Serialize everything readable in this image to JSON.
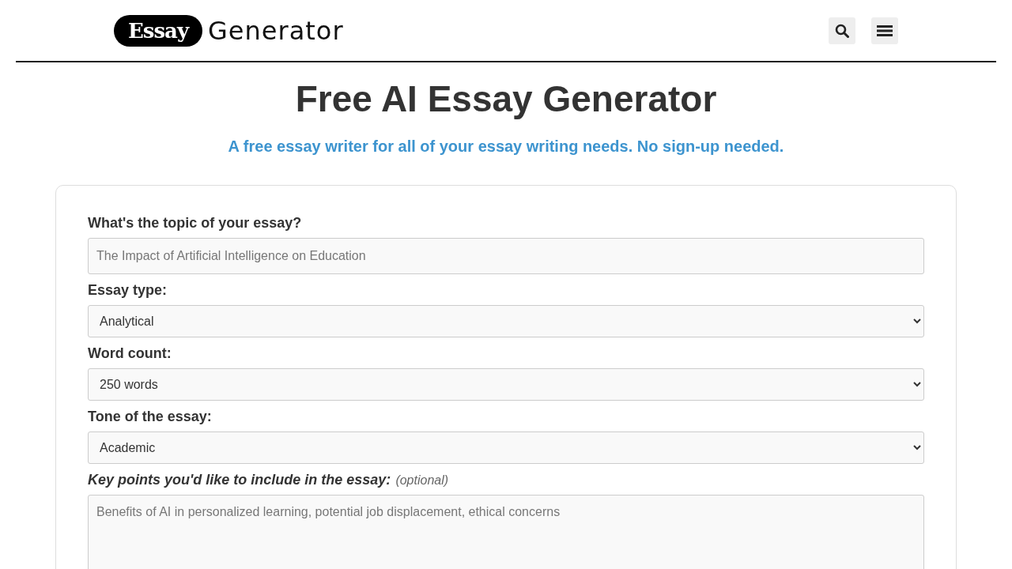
{
  "header": {
    "logo_badge": "Essay",
    "logo_text": "Generator"
  },
  "hero": {
    "title": "Free AI Essay Generator",
    "subtitle": "A free essay writer for all of your essay writing needs. No sign-up needed."
  },
  "form": {
    "fields": [
      {
        "kind": "text",
        "label": "What's the topic of your essay?",
        "placeholder": "The Impact of Artificial Intelligence on Education"
      },
      {
        "kind": "select",
        "label": "Essay type:",
        "value": "Analytical"
      },
      {
        "kind": "select",
        "label": "Word count:",
        "value": "250 words"
      },
      {
        "kind": "select",
        "label": "Tone of the essay:",
        "value": "Academic"
      },
      {
        "kind": "textarea",
        "label": "Key points you'd like to include in the essay:",
        "hint": "(optional)",
        "placeholder": "Benefits of AI in personalized learning, potential job displacement, ethical concerns"
      }
    ]
  }
}
